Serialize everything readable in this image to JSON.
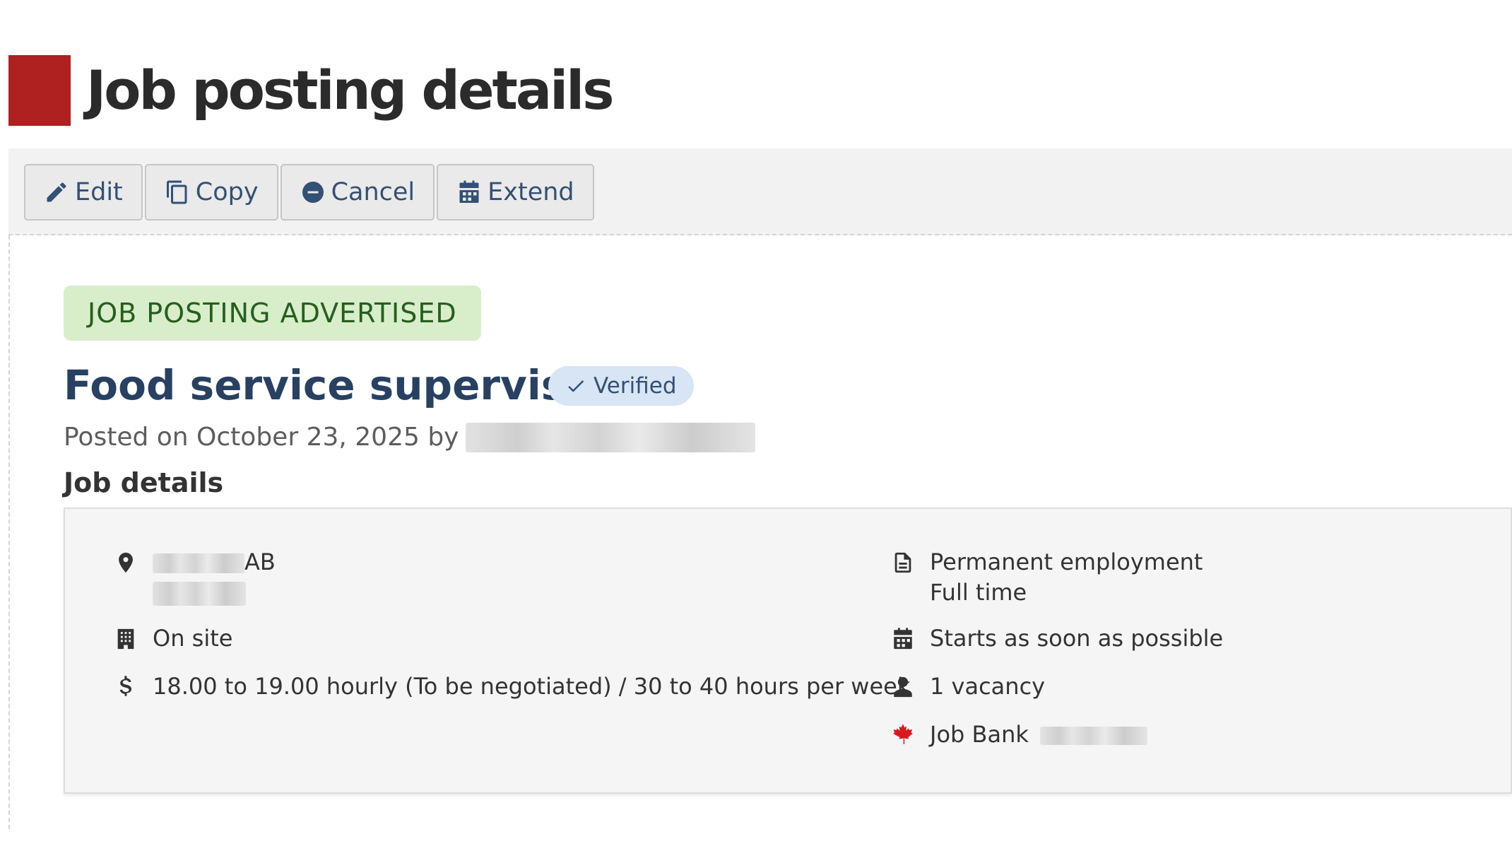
{
  "page": {
    "title": "Job posting details",
    "accent_color": "#af2020"
  },
  "toolbar": {
    "buttons": [
      {
        "label": "Edit",
        "icon": "pencil-icon"
      },
      {
        "label": "Copy",
        "icon": "copy-icon"
      },
      {
        "label": "Cancel",
        "icon": "minus-circle-icon"
      },
      {
        "label": "Extend",
        "icon": "calendar-icon"
      }
    ]
  },
  "status": {
    "label": "JOB POSTING ADVERTISED",
    "bg_color": "#d8eeca",
    "text_color": "#265e1f"
  },
  "job": {
    "title": "Food service supervisor",
    "verified_label": "Verified",
    "verified_bg": "#d7e5f5",
    "verified_text_color": "#335075",
    "posted_prefix": "Posted on October 23, 2025 by"
  },
  "details": {
    "heading": "Job details",
    "location_suffix": "AB",
    "work_setting": "On site",
    "salary": "18.00 to 19.00 hourly (To be negotiated) / 30 to 40 hours per week",
    "employment_type": "Permanent employment",
    "employment_hours": "Full time",
    "start": "Starts as soon as possible",
    "vacancies": "1 vacancy",
    "source_prefix": "Job Bank",
    "maple_color": "#d71920"
  }
}
